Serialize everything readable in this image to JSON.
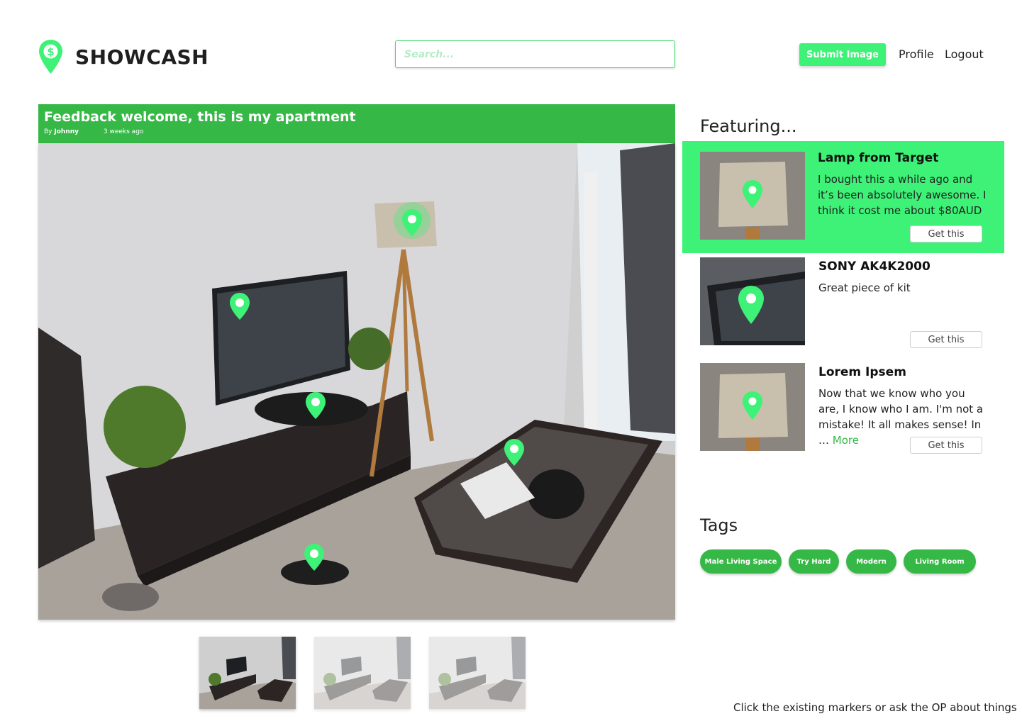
{
  "header": {
    "brand": "SHOWCASH",
    "search_placeholder": "Search...",
    "submit_label": "Submit Image",
    "profile_label": "Profile",
    "logout_label": "Logout"
  },
  "post": {
    "title": "Feedback welcome, this is my apartment",
    "by_label": "By",
    "author": "Johnny",
    "time": "3 weeks ago"
  },
  "featuring": {
    "heading": "Featuring...",
    "items": [
      {
        "title": "Lamp from Target",
        "description": "I bought this a while ago and it’s been absolutely awesome. I think it cost me about $80AUD",
        "button": "Get this"
      },
      {
        "title": "SONY AK4K2000",
        "description": "Great piece of kit",
        "button": "Get this"
      },
      {
        "title": "Lorem Ipsem",
        "description": "Now that we know who you are, I know who I am. I'm not a mistake! It all makes sense! In …",
        "more": "More",
        "button": "Get this"
      }
    ]
  },
  "tags": {
    "heading": "Tags",
    "items": [
      "Male Living Space",
      "Try Hard",
      "Modern",
      "Living Room"
    ]
  },
  "footer": {
    "note": "Click the existing markers or ask the OP about things"
  },
  "colors": {
    "brand_green": "#36b847",
    "accent_green": "#3df277"
  },
  "icons": [
    "location-marker-icon",
    "dollar-pin-logo-icon"
  ]
}
